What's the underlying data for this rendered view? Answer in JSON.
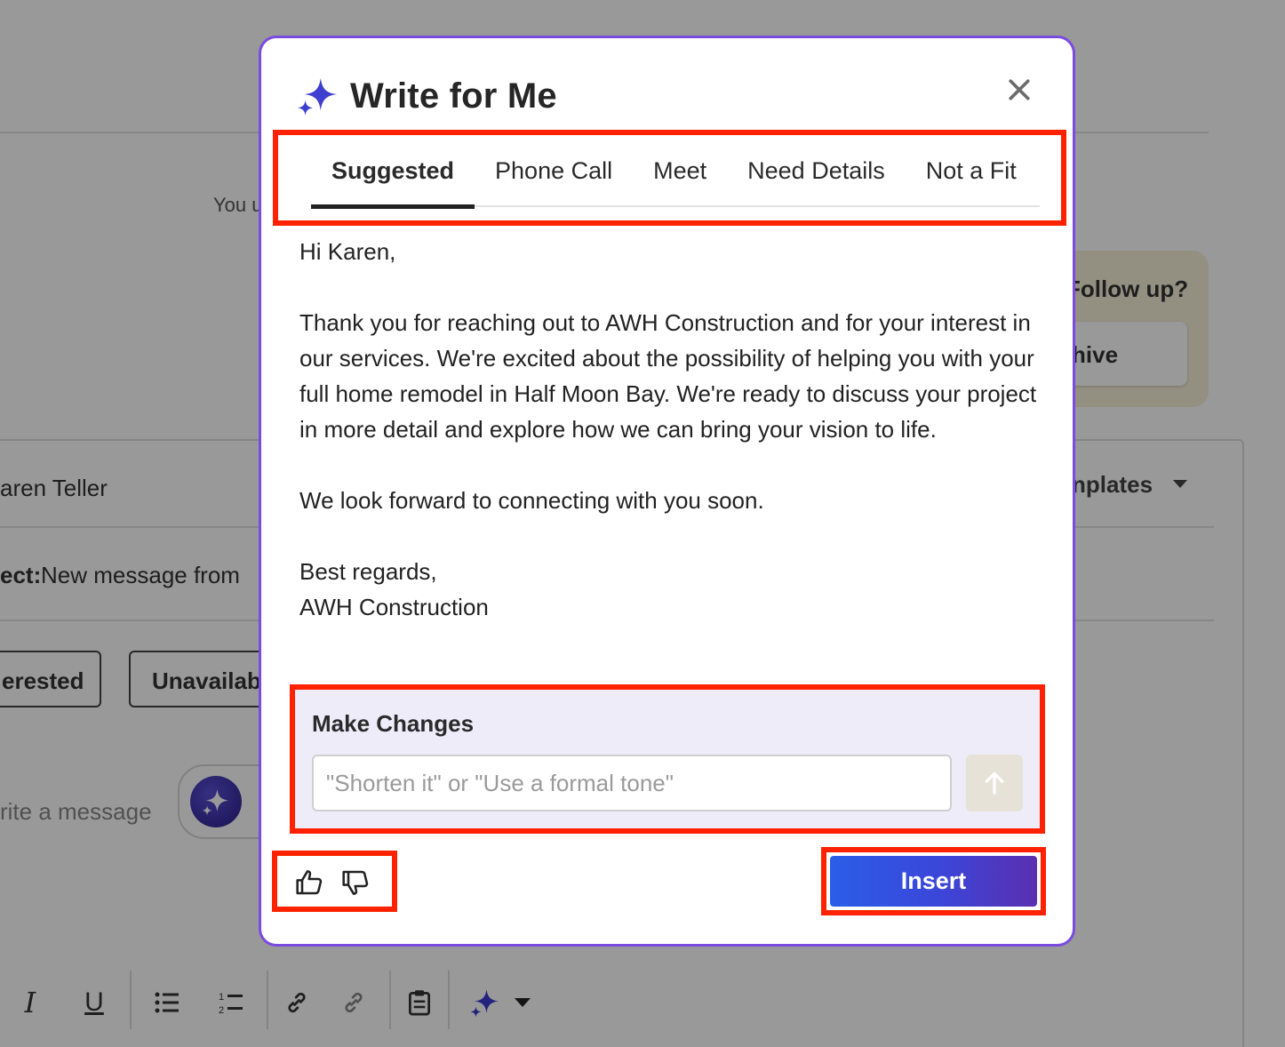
{
  "background": {
    "notice_text": "You u",
    "followup": {
      "title": "Follow up?",
      "archive_label": "hive"
    },
    "compose": {
      "to_value": "aren Teller",
      "templates_label": "nplates",
      "subject_label": "ect:",
      "subject_value": "New message from",
      "chips": [
        "erested",
        "Unavailab"
      ],
      "message_placeholder": "rite a message"
    }
  },
  "modal": {
    "title": "Write for Me",
    "tabs": [
      {
        "label": "Suggested",
        "active": true
      },
      {
        "label": "Phone Call",
        "active": false
      },
      {
        "label": "Meet",
        "active": false
      },
      {
        "label": "Need Details",
        "active": false
      },
      {
        "label": "Not a Fit",
        "active": false
      }
    ],
    "message": {
      "greeting": "Hi Karen,",
      "paragraph1": "Thank you for reaching out to AWH Construction and for your interest in our services. We're excited about the possibility of helping you with your full home remodel in Half Moon Bay. We're ready to discuss your project in more detail and explore how we can bring your vision to life.",
      "paragraph2": "We look forward to connecting with you soon.",
      "signoff": "Best regards,",
      "signature": "AWH Construction"
    },
    "make_changes": {
      "label": "Make Changes",
      "placeholder": "\"Shorten it\" or \"Use a formal tone\""
    },
    "insert_label": "Insert"
  },
  "colors": {
    "accent": "#7a4be0",
    "highlight": "#ff2200",
    "insert_gradient_start": "#2a5ee8",
    "insert_gradient_end": "#5a2fb0"
  },
  "icons": {
    "title": "sparkle-icon",
    "close": "close-icon",
    "send": "arrow-up-icon",
    "like": "thumbs-up-icon",
    "dislike": "thumbs-down-icon"
  }
}
